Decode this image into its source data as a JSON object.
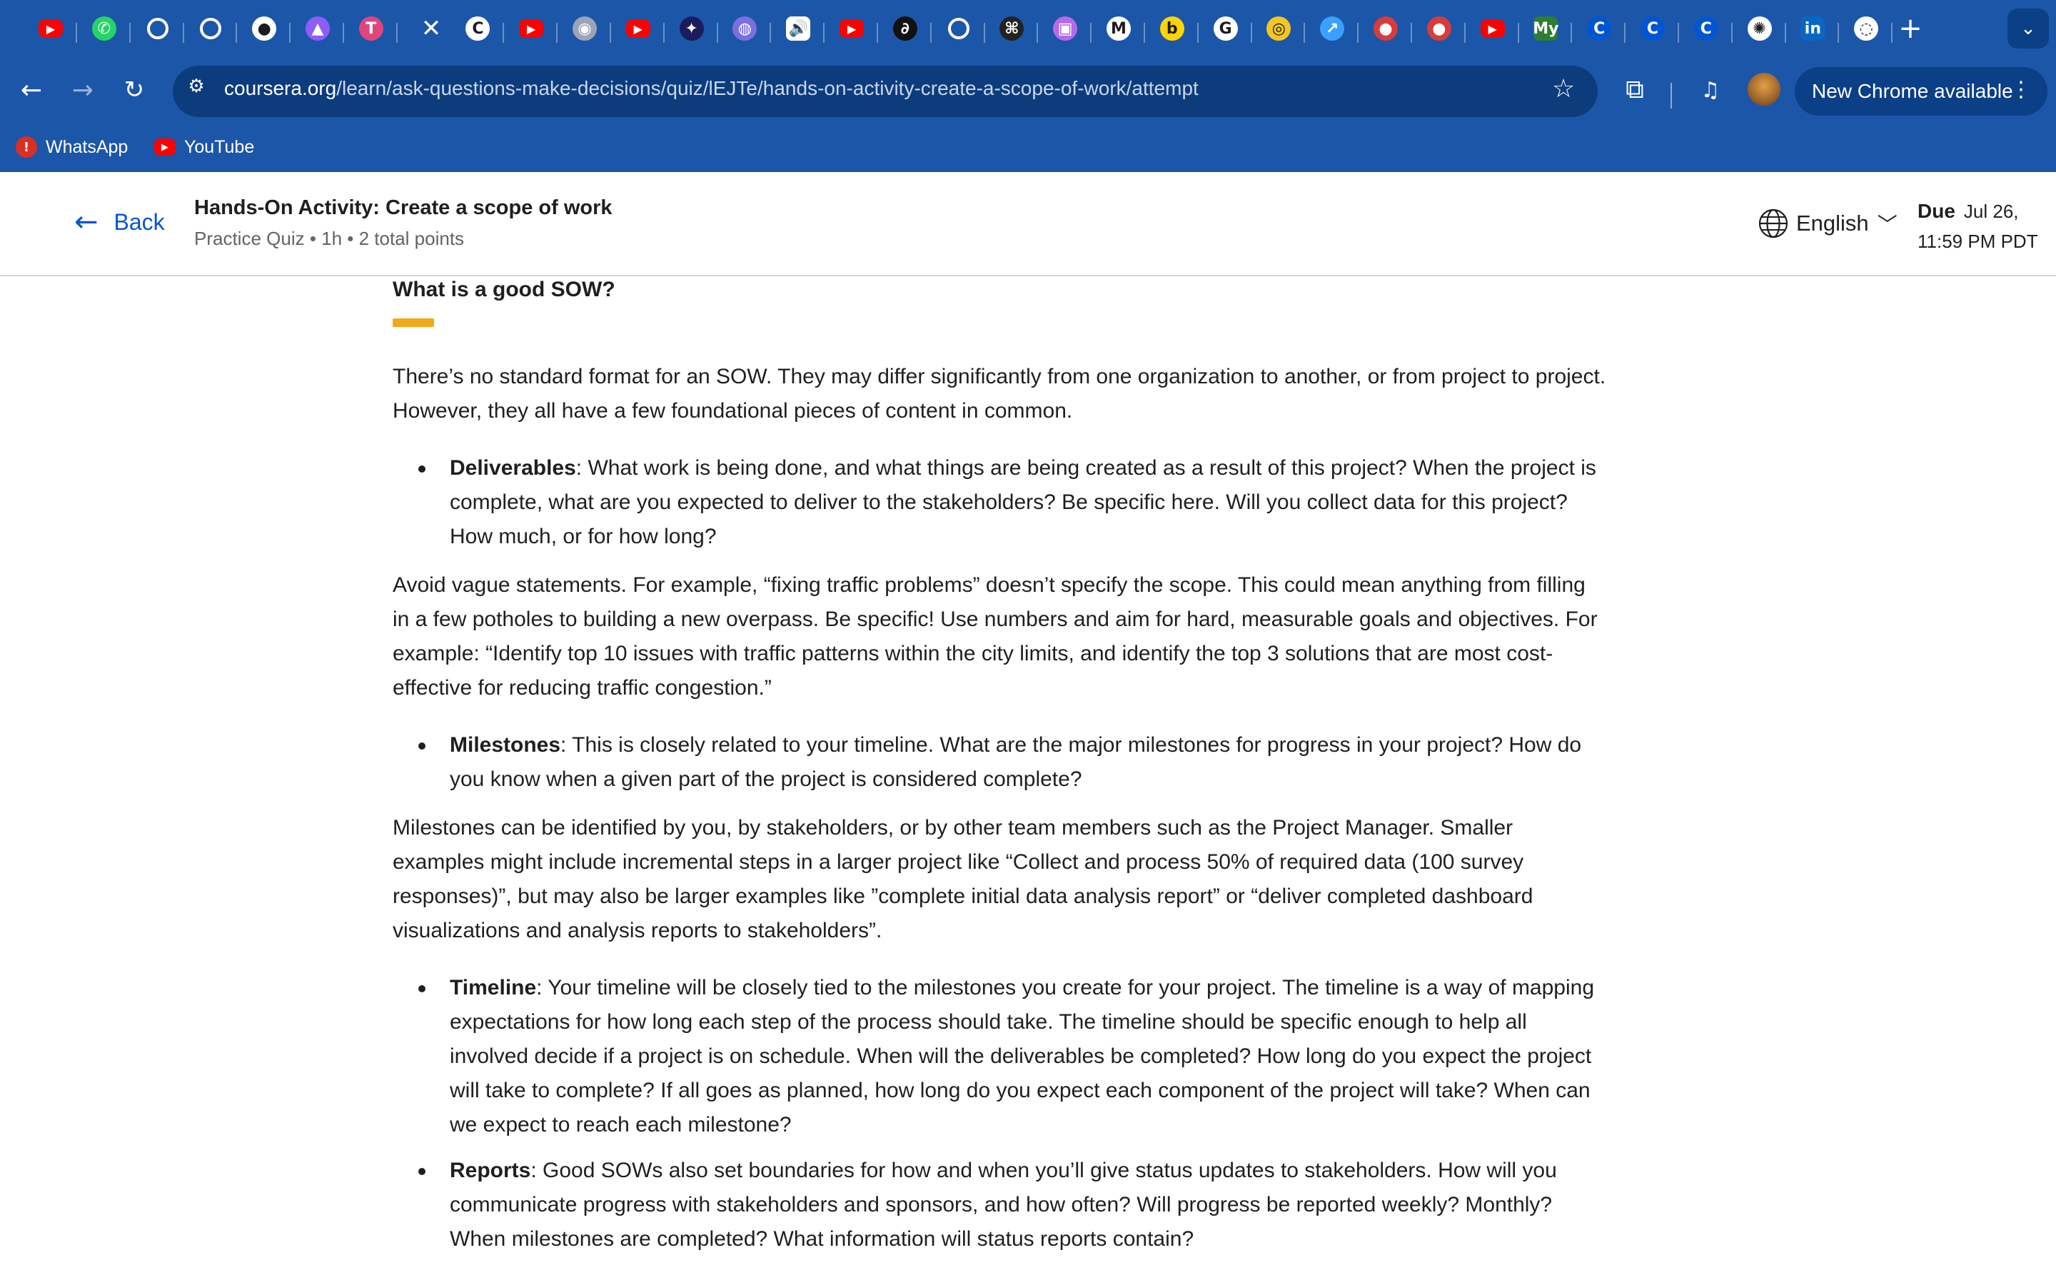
{
  "browser": {
    "tabs": [
      {
        "icon": "youtube-icon",
        "color": "#ff0000",
        "glyph": "▶"
      },
      {
        "icon": "whatsapp-icon",
        "color": "#25d366",
        "glyph": "✆"
      },
      {
        "icon": "loading-icon",
        "color": "#ffffff",
        "glyph": ""
      },
      {
        "icon": "loading-icon",
        "color": "#ffffff",
        "glyph": ""
      },
      {
        "icon": "github-icon",
        "color": "#ffffff",
        "glyph": "●"
      },
      {
        "icon": "app-icon",
        "color": "#8e5cf7",
        "glyph": "▲"
      },
      {
        "icon": "app-icon",
        "color": "#e0457b",
        "glyph": "T"
      },
      {
        "icon": "close-icon",
        "color": "#ffffff",
        "glyph": "✕",
        "active": true
      },
      {
        "icon": "coursera-icon",
        "color": "#ffffff",
        "glyph": "C"
      },
      {
        "icon": "youtube-icon",
        "color": "#ff0000",
        "glyph": "▶"
      },
      {
        "icon": "app-icon",
        "color": "#9aa4b5",
        "glyph": "◉"
      },
      {
        "icon": "youtube-icon",
        "color": "#ff0000",
        "glyph": "▶"
      },
      {
        "icon": "app-icon",
        "color": "#1b1b5e",
        "glyph": "✦"
      },
      {
        "icon": "app-icon",
        "color": "#7b6fe0",
        "glyph": "◍"
      },
      {
        "icon": "audio-icon",
        "color": "#ffffff",
        "glyph": "🔊"
      },
      {
        "icon": "youtube-icon",
        "color": "#ff0000",
        "glyph": "▶"
      },
      {
        "icon": "app-icon",
        "color": "#111111",
        "glyph": "∂"
      },
      {
        "icon": "loading-icon",
        "color": "#ffffff",
        "glyph": ""
      },
      {
        "icon": "app-icon",
        "color": "#222222",
        "glyph": "⌘"
      },
      {
        "icon": "app-icon",
        "color": "#b46be6",
        "glyph": "▣"
      },
      {
        "icon": "app-icon",
        "color": "#ffffff",
        "glyph": "M"
      },
      {
        "icon": "app-icon",
        "color": "#ffd500",
        "glyph": "b"
      },
      {
        "icon": "google-icon",
        "color": "#ffffff",
        "glyph": "G"
      },
      {
        "icon": "app-icon",
        "color": "#f3c623",
        "glyph": "◎"
      },
      {
        "icon": "app-icon",
        "color": "#3aa0ff",
        "glyph": "↗"
      },
      {
        "icon": "app-icon",
        "color": "#d93b3b",
        "glyph": "●"
      },
      {
        "icon": "app-icon",
        "color": "#d93b3b",
        "glyph": "●"
      },
      {
        "icon": "youtube-icon",
        "color": "#ff0000",
        "glyph": "▶"
      },
      {
        "icon": "myunt-icon",
        "color": "#2e7d32",
        "glyph": "My"
      },
      {
        "icon": "coursera-icon",
        "color": "#0056d2",
        "glyph": "C"
      },
      {
        "icon": "coursera-icon",
        "color": "#0056d2",
        "glyph": "C"
      },
      {
        "icon": "coursera-icon",
        "color": "#0056d2",
        "glyph": "C"
      },
      {
        "icon": "chatgpt-icon",
        "color": "#ffffff",
        "glyph": "✺"
      },
      {
        "icon": "linkedin-icon",
        "color": "#0a66c2",
        "glyph": "in"
      },
      {
        "icon": "github-icon",
        "color": "#ffffff",
        "glyph": "◌"
      }
    ],
    "url_host": "coursera.org",
    "url_path": "/learn/ask-questions-make-decisions/quiz/lEJTe/hands-on-activity-create-a-scope-of-work/attempt",
    "update_label": "New Chrome available",
    "bookmarks": [
      {
        "label": "WhatsApp",
        "icon": "whatsapp-alert-icon",
        "color": "#d93025",
        "glyph": "!"
      },
      {
        "label": "YouTube",
        "icon": "youtube-icon",
        "color": "#ff0000",
        "glyph": "▶"
      }
    ]
  },
  "header": {
    "back_label": "Back",
    "title": "Hands-On Activity: Create a scope of work",
    "meta": "Practice Quiz • 1h • 2 total points",
    "language": "English",
    "due_label": "Due",
    "due_date": "Jul 26,",
    "due_time": "11:59 PM PDT"
  },
  "content": {
    "heading": "What is a good SOW?",
    "intro": "There’s no standard format for an SOW. They may differ significantly from one organization to another, or from project to project. However, they all have a few foundational pieces of content in common.",
    "deliverables_term": "Deliverables",
    "deliverables_text": ": What work is being done, and what things are being created as a result of this project? When the project is complete, what are you expected to deliver to the stakeholders? Be specific here. Will you collect data for this project? How much, or for how long?",
    "deliverables_para": "Avoid vague statements. For example, “fixing traffic problems” doesn’t specify the scope. This could mean anything from filling in a few potholes to building a new overpass. Be specific! Use numbers and aim for hard, measurable goals and objectives. For example: “Identify top 10 issues with traffic patterns within the city limits, and identify the top 3 solutions that are most cost-effective for reducing traffic congestion.”",
    "milestones_term": "Milestones",
    "milestones_text": ": This is closely related to your timeline. What are the major milestones for progress in your project? How do you know when a given part of the project is considered complete?",
    "milestones_para": "Milestones can be identified by you, by stakeholders, or by other team members such as the Project Manager. Smaller examples might include incremental steps in a larger project like “Collect and process 50% of required data (100 survey responses)”, but may also be larger examples like ”complete initial data analysis report” or “deliver completed dashboard visualizations and analysis reports to stakeholders”.",
    "timeline_term": "Timeline",
    "timeline_text": ": Your timeline will be closely tied to the milestones you create for your project. The timeline is a way of mapping expectations for how long each step of the process should take. The timeline should be specific enough to help all involved decide if a project is on schedule. When will the deliverables be completed? How long do you expect the project will take to complete? If all goes as planned, how long do you expect each component of the project will take? When can we expect to reach each milestone?",
    "reports_term": "Reports",
    "reports_text": ": Good SOWs also set boundaries for how and when you’ll give status updates to stakeholders. How will you communicate progress with stakeholders and sponsors, and how often? Will progress be reported weekly? Monthly? When milestones are completed? What information will status reports contain?"
  },
  "colors": {
    "chrome_blue": "#1c56a8",
    "omnibox": "#0d3c7d",
    "coursera_blue": "#0056d2",
    "accent_bar": "#f1a81d"
  }
}
